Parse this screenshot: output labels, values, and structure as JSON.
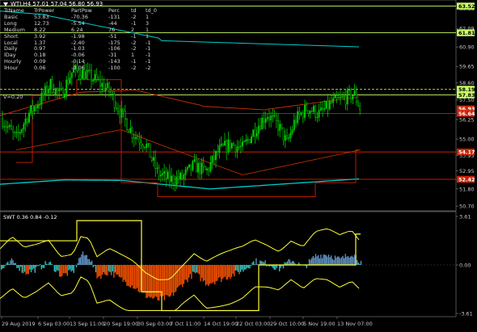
{
  "header": {
    "title": "WTI,H4 57.01 57.04 56.80 56.93"
  },
  "table": {
    "columns": [
      "TrName",
      "TrPower",
      "PartPow",
      "Perc",
      "td",
      "td_0"
    ],
    "rows": [
      [
        "Basic",
        "53.83",
        "-70.36",
        "-131",
        "-2",
        "1"
      ],
      [
        "Long",
        "12.73",
        "-5.54",
        "-44",
        "-1",
        "3"
      ],
      [
        "Medium",
        "8.22",
        "6.24",
        "76",
        "2",
        "1"
      ],
      [
        "Short",
        "3.92",
        "-1.98",
        "-51",
        "-1",
        "1"
      ],
      [
        "Local",
        "1.37",
        "-2.40",
        "-175",
        "-2",
        "-1"
      ],
      [
        "Daily",
        "0.97",
        "-1.03",
        "-106",
        "-2",
        "-1"
      ],
      [
        "lDay",
        "0.18",
        "-0.06",
        "-31",
        "1",
        "-1"
      ],
      [
        "Hourly",
        "0.09",
        "-0.14",
        "-143",
        "-1",
        "-1"
      ],
      [
        "lHour",
        "0.06",
        "-0.06",
        "-100",
        "-2",
        "-2"
      ]
    ],
    "v_label": "V=0.20"
  },
  "price_axis": {
    "labels": [
      "63.35",
      "62.09",
      "60.90",
      "59.65",
      "58.60",
      "57.50",
      "56.25",
      "55.00",
      "53.95",
      "52.95",
      "51.80",
      "50.70"
    ],
    "badges": [
      {
        "text": "63.52",
        "bg": "#ccff66"
      },
      {
        "text": "61.81",
        "bg": "#ccff66"
      },
      {
        "text": "58.19",
        "bg": "#ccff66"
      },
      {
        "text": "57.83",
        "bg": "#ccff66"
      },
      {
        "text": "56.93",
        "bg": "#cc2200"
      },
      {
        "text": "56.64",
        "bg": "#cc2200"
      },
      {
        "text": "54.17",
        "bg": "#cc2200"
      },
      {
        "text": "52.42",
        "bg": "#cc2200"
      }
    ]
  },
  "subwindow": {
    "title": "SWT 0.36 0.84 -0.12",
    "axis_labels": [
      "3.61",
      "0.00",
      "-3.61"
    ]
  },
  "time_axis": {
    "labels": [
      "29 Aug 2019",
      "6 Sep 03:00",
      "13 Sep 11:00",
      "20 Sep 19:00",
      "30 Sep 03:00",
      "7 Oct 11:00",
      "14 Oct 19:00",
      "22 Oct 03:00",
      "29 Oct 10:00",
      "5 Nov 19:00",
      "13 Nov 07:00"
    ]
  },
  "colors": {
    "candle_up": "#00cc00",
    "candle_down": "#00cc00",
    "ma_fast": "#cc3300",
    "ma_slow": "#00cccc",
    "level_line": "#ccff66",
    "stop_line": "#cc2200",
    "band": "#ffff33",
    "hist_orange": "#ff5500",
    "hist_blue": "#6699cc",
    "hist_teal": "#33cccc"
  }
}
